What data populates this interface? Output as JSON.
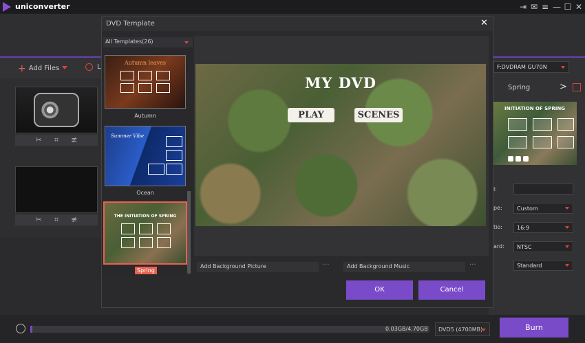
{
  "app": {
    "title": "uniconverter",
    "window_controls": [
      "⇥",
      "✉",
      "≡",
      "—",
      "☐",
      "✕"
    ]
  },
  "toolbar": {
    "add_files": "Add Files",
    "load_dvd_partial": "L"
  },
  "bottom": {
    "capacity": "0.03GB/4.70GB",
    "disc": "DVD5 (4700MB)",
    "burn": "Burn",
    "progress_fraction": 0.006
  },
  "right_panel": {
    "drive_select": "F:DVDRAM GU70N",
    "template_name": "Spring",
    "preview_title": "INITIATION OF SPRING",
    "fields": [
      {
        "label": "l:",
        "value": ""
      },
      {
        "label": "pe:",
        "value": "Custom"
      },
      {
        "label": "tio:",
        "value": "16:9"
      },
      {
        "label": "ard:",
        "value": "NTSC"
      },
      {
        "label": "",
        "value": "Standard"
      }
    ]
  },
  "dialog": {
    "title": "DVD Template",
    "close_icon": "close-icon",
    "filter": "All Templates(26)",
    "templates": [
      {
        "name": "Autumn",
        "thumb_title": "Autumn leaves"
      },
      {
        "name": "Ocean",
        "thumb_title": "Summer Vibe"
      },
      {
        "name": "Spring",
        "thumb_title": "THE INITIATION OF SPRING",
        "selected": true
      }
    ],
    "preview": {
      "title": "MY DVD",
      "play": "PLAY",
      "scenes": "SCENES"
    },
    "add_background_picture": "Add Background Picture",
    "add_background_music": "Add Background Music",
    "more": "···",
    "ok": "OK",
    "cancel": "Cancel"
  },
  "colors": {
    "accent": "#7a4bc8",
    "highlight": "#e8624f"
  }
}
